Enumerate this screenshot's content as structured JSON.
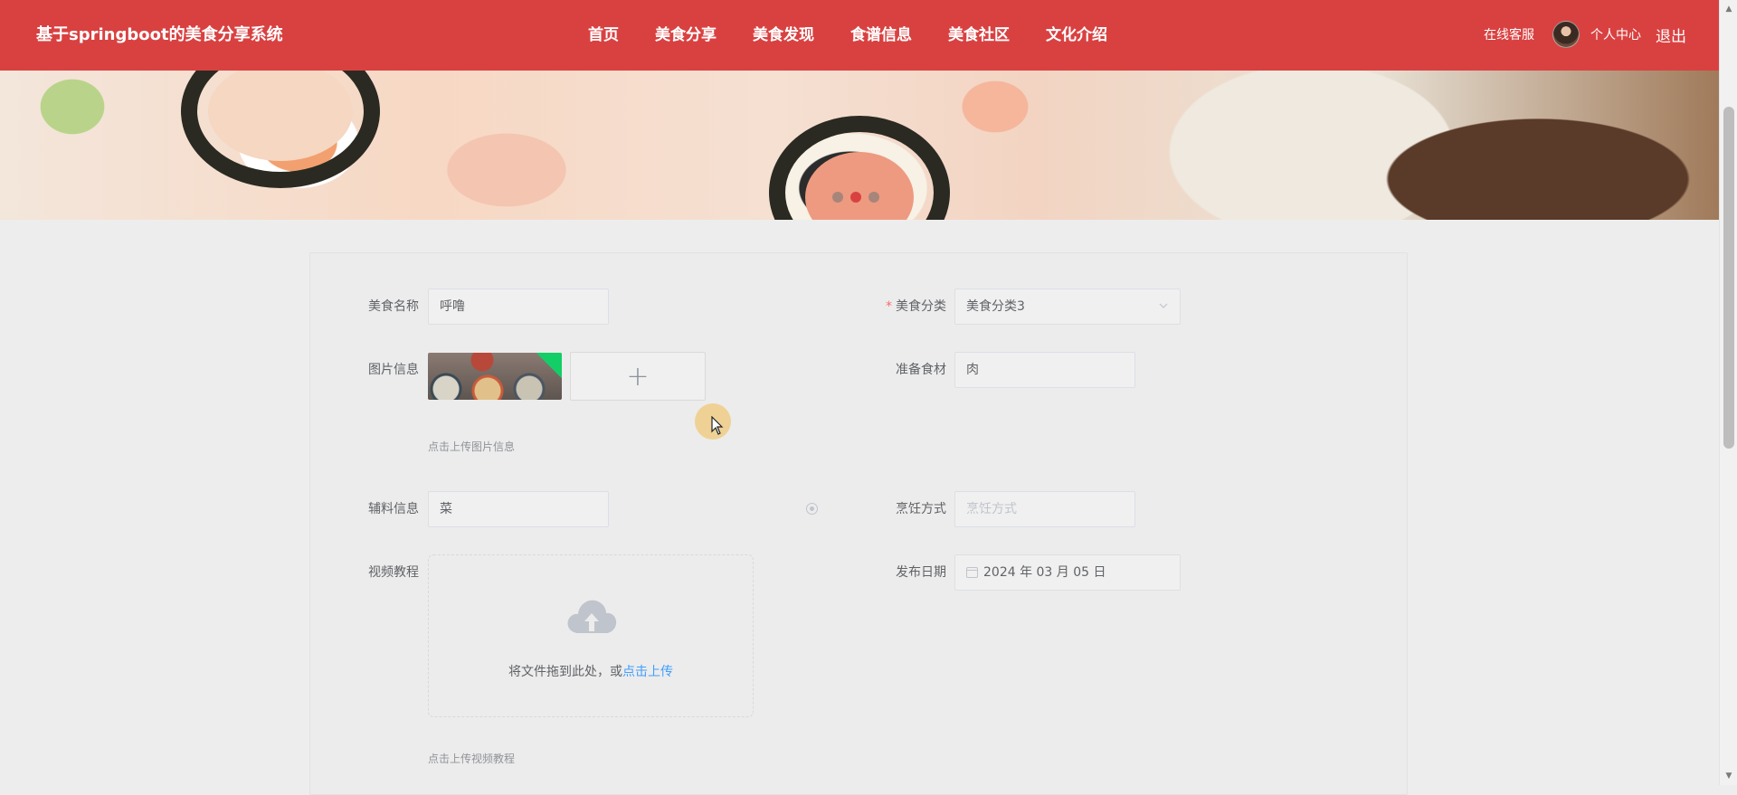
{
  "theme": {
    "accent": "#d94141",
    "link": "#409eff",
    "success": "#13ce66"
  },
  "header": {
    "brand": "基于springboot的美食分享系统",
    "nav": [
      {
        "label": "首页"
      },
      {
        "label": "美食分享"
      },
      {
        "label": "美食发现"
      },
      {
        "label": "食谱信息"
      },
      {
        "label": "美食社区"
      },
      {
        "label": "文化介绍"
      }
    ],
    "service_link": "在线客服",
    "profile_link": "个人中心",
    "logout": "退出"
  },
  "banner": {
    "slides": 3,
    "active_slide": 2
  },
  "form": {
    "food_name": {
      "label": "美食名称",
      "value": "呼噜"
    },
    "category": {
      "label": "美食分类",
      "required": true,
      "value": "美食分类3",
      "arrow": "chevron-down-icon"
    },
    "image": {
      "label": "图片信息",
      "hint": "点击上传图片信息",
      "add_icon": "plus-icon"
    },
    "ingredients": {
      "label": "准备食材",
      "value": "肉"
    },
    "auxiliary": {
      "label": "辅料信息",
      "value": "菜"
    },
    "cooking_method": {
      "label": "烹饪方式",
      "placeholder": "烹饪方式"
    },
    "video": {
      "label": "视频教程",
      "drop_text": "将文件拖到此处，或",
      "drop_link": "点击上传",
      "hint": "点击上传视频教程",
      "icon": "cloud-upload-icon"
    },
    "publish_date": {
      "label": "发布日期",
      "value": "2024 年 03 月 05 日",
      "icon": "calendar-icon"
    }
  }
}
